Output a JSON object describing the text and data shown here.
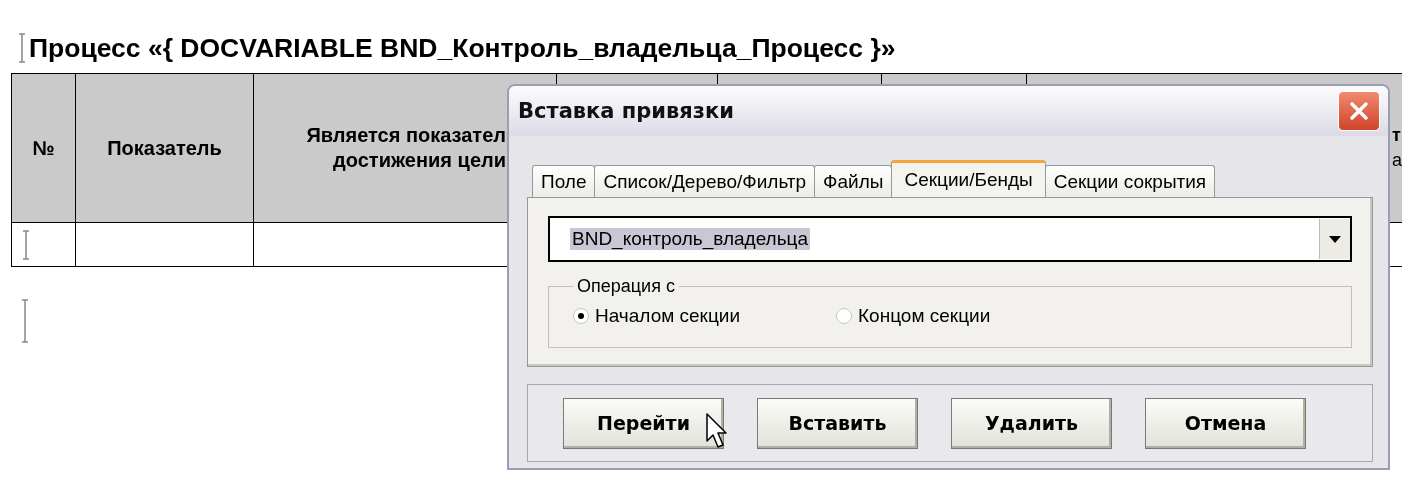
{
  "document": {
    "heading": "Процесс «{ DOCVARIABLE BND_Контроль_владельца_Процесс }»",
    "table": {
      "columns": [
        {
          "lines": [
            "№"
          ]
        },
        {
          "lines": [
            "Показатель"
          ]
        },
        {
          "lines": [
            "Является показател",
            "достижения цели"
          ]
        },
        {},
        {},
        {},
        {
          "lines": [
            "т",
            "а"
          ]
        }
      ]
    }
  },
  "dialog": {
    "title": "Вставка привязки",
    "tabs": [
      {
        "label": "Поле",
        "selected": false
      },
      {
        "label": "Список/Дерево/Фильтр",
        "selected": false
      },
      {
        "label": "Файлы",
        "selected": false
      },
      {
        "label": "Секции/Бенды",
        "selected": true
      },
      {
        "label": "Секции сокрытия",
        "selected": false
      }
    ],
    "combo": {
      "value": "BND_контроль_владельца"
    },
    "group": {
      "label": "Операция с",
      "options": [
        {
          "label": "Началом секции",
          "selected": true
        },
        {
          "label": "Концом секции",
          "selected": false
        }
      ]
    },
    "buttons": [
      "Перейти",
      "Вставить",
      "Удалить",
      "Отмена"
    ]
  }
}
